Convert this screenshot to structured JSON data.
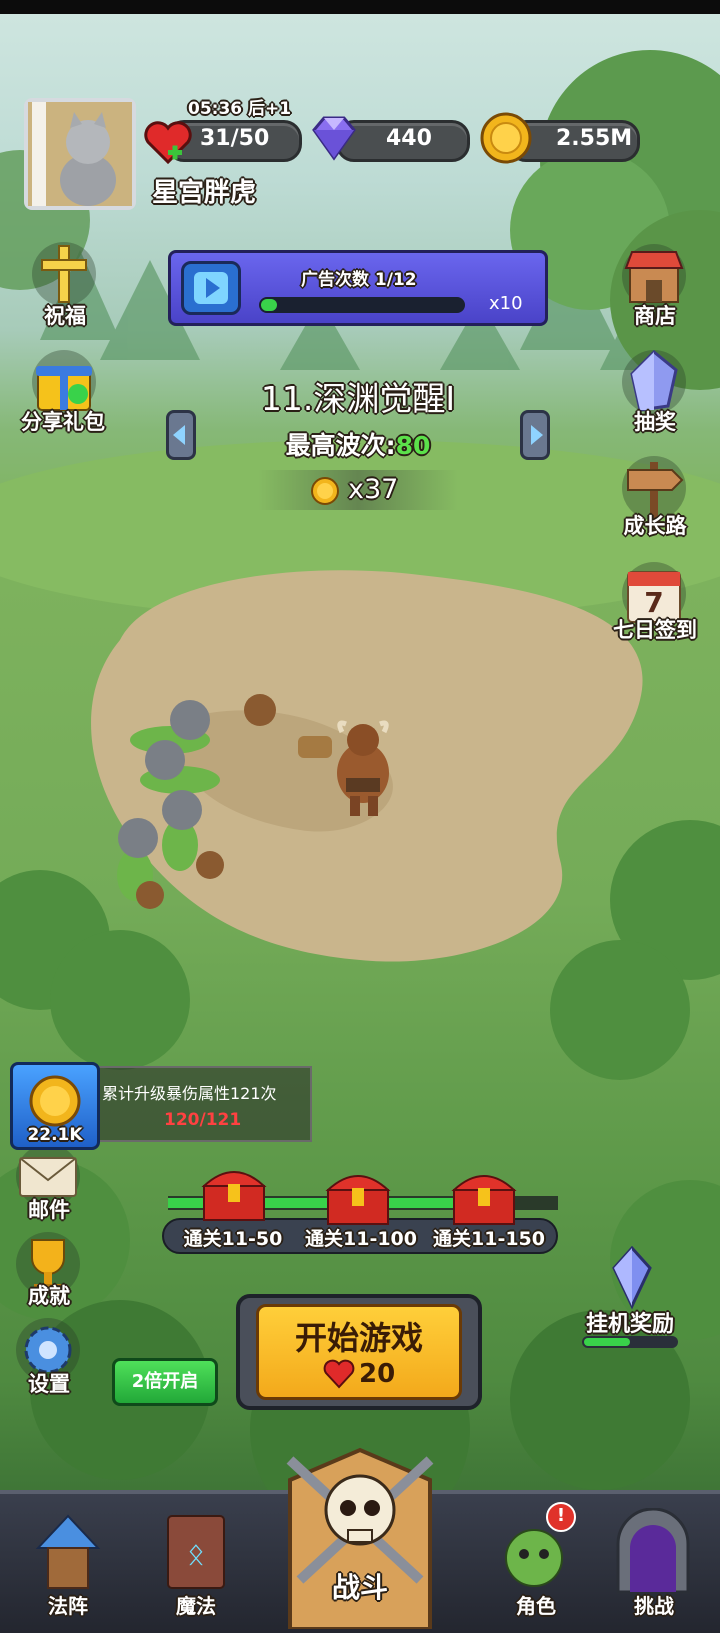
{
  "player": {
    "name": "星宫胖虎",
    "energy_timer": "05:36 后+1",
    "energy": "31/50",
    "gems": "440",
    "gold": "2.55M"
  },
  "ad_bar": {
    "label": "广告次数 1/12",
    "multiplier": "x10",
    "progress": 0.08
  },
  "level": {
    "title": "11.深渊觉醒I",
    "best_wave_label": "最高波次:",
    "best_wave_value": "80",
    "reward": "x37"
  },
  "left_menu": {
    "bless": "祝福",
    "share_gift": "分享礼包",
    "mail": "邮件",
    "achievement": "成就",
    "settings": "设置"
  },
  "right_menu": {
    "shop": "商店",
    "lottery": "抽奖",
    "growth": "成长路",
    "checkin": "七日签到",
    "checkin_day": "7",
    "idle_reward": "挂机奖励"
  },
  "quest": {
    "text": "累计升级暴伤属性121次",
    "progress": "120/121",
    "amount": "22.1K"
  },
  "chests": [
    {
      "label": "通关11-50"
    },
    {
      "label": "通关11-100"
    },
    {
      "label": "通关11-150"
    }
  ],
  "double_button": "2倍开启",
  "start_button": {
    "label": "开始游戏",
    "cost": "20"
  },
  "nav": {
    "formation": "法阵",
    "magic": "魔法",
    "battle": "战斗",
    "character": "角色",
    "challenge": "挑战",
    "character_alert": "!"
  },
  "colors": {
    "accent_green": "#39d24a",
    "start_button": "#f3a91b",
    "wave_green": "#5be04a",
    "progress_red": "#ff4141"
  }
}
